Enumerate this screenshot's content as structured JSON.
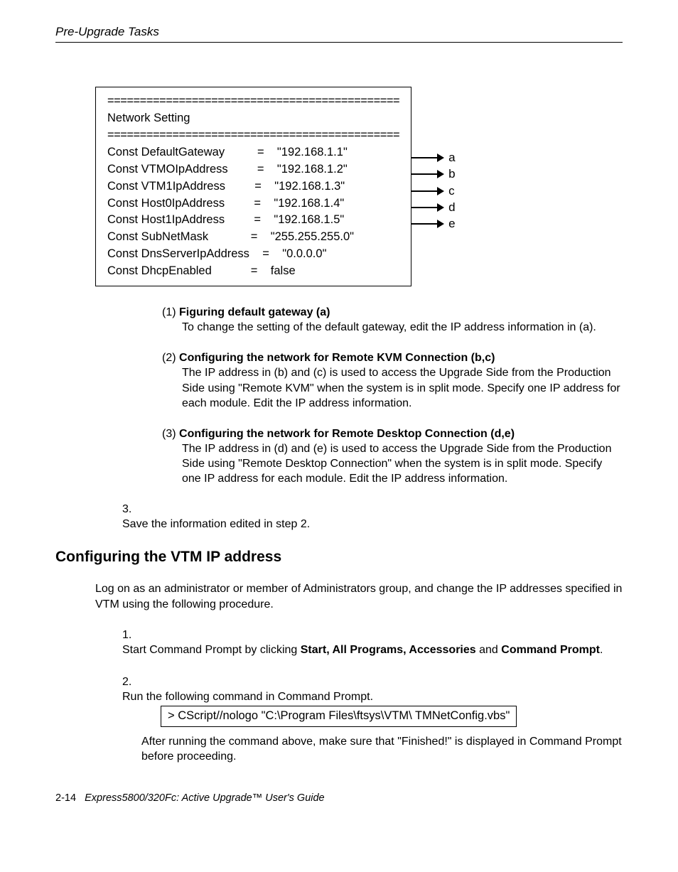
{
  "header": {
    "title": "Pre-Upgrade Tasks"
  },
  "config_box": {
    "separator": "=============================================",
    "section_title": "Network Setting",
    "rows": [
      {
        "key": "Const DefaultGateway",
        "eq": "=",
        "val": "\"192.168.1.1\"",
        "arrow_label": "a"
      },
      {
        "key": "Const VTMOIpAddress",
        "eq": "=",
        "val": "\"192.168.1.2\"",
        "arrow_label": "b"
      },
      {
        "key": "Const VTM1IpAddress",
        "eq": "=",
        "val": "\"192.168.1.3\"",
        "arrow_label": "c"
      },
      {
        "key": "Const Host0IpAddress",
        "eq": "=",
        "val": "\"192.168.1.4\"",
        "arrow_label": "d"
      },
      {
        "key": "Const Host1IpAddress",
        "eq": "=",
        "val": "\"192.168.1.5\"",
        "arrow_label": "e"
      },
      {
        "key": "Const SubNetMask",
        "eq": "=",
        "val": "\"255.255.255.0\""
      },
      {
        "key": "Const DnsServerIpAddress",
        "eq": "=",
        "val": "\"0.0.0.0\""
      },
      {
        "key": "Const DhcpEnabled",
        "eq": "=",
        "val": "false"
      }
    ]
  },
  "sub_items": {
    "item1": {
      "num": "(1)",
      "title": "Figuring default gateway (a)",
      "body": "To change the setting of the default gateway, edit the IP address information in (a)."
    },
    "item2": {
      "num": "(2)",
      "title": "Configuring the network for Remote KVM Connection (b,c)",
      "body": "The IP address in (b) and (c) is used to access the Upgrade Side from the Production Side using \"Remote KVM\" when the system is in split mode. Specify one IP address for each module. Edit the IP address information."
    },
    "item3": {
      "num": "(3)",
      "title": "Configuring the network for Remote Desktop Connection (d,e)",
      "body": "The IP address in (d) and (e) is used to access the Upgrade Side from the Production Side using \"Remote Desktop Connection\" when the system is in split mode. Specify one IP address for each module. Edit the IP address information."
    }
  },
  "step3": {
    "num": "3.",
    "text": "Save the information edited in step 2."
  },
  "h2": "Configuring the VTM IP address",
  "intro_para": "Log on as an administrator or member of Administrators group, and change the IP addresses specified in VTM using the following procedure.",
  "p_step1": {
    "num": "1.",
    "prefix": "Start Command Prompt by clicking ",
    "bold1": "Start, All Programs, Accessories",
    "mid": " and ",
    "bold2": "Command Prompt",
    "suffix": "."
  },
  "p_step2": {
    "num": "2.",
    "text": "Run the following command in Command Prompt.",
    "cmd": "> CScript//nologo \"C:\\Program Files\\ftsys\\VTM\\   TMNetConfig.vbs\"",
    "after": "After running the command above, make sure that \"Finished!\" is displayed in Command Prompt before proceeding."
  },
  "footer": {
    "page": "2-14",
    "title": "Express5800/320Fc: Active Upgrade™ User's Guide"
  }
}
